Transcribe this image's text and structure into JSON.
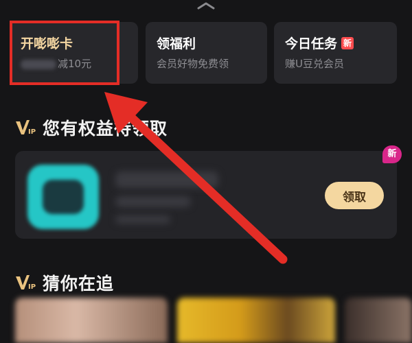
{
  "quick_cards": [
    {
      "title": "开嘭嘭卡",
      "subtitle": "减10元"
    },
    {
      "title": "领福利",
      "subtitle": "会员好物免费领"
    },
    {
      "title": "今日任务",
      "badge": "新",
      "subtitle": "赚U豆兑会员"
    }
  ],
  "rights_section": {
    "title": "您有权益待领取",
    "claim_label": "领取",
    "corner_badge": "新"
  },
  "follow_section": {
    "title": "猜你在追"
  },
  "icons": {
    "vip": "vip-icon",
    "collapse": "chevron-up-icon"
  },
  "colors": {
    "accent_gold": "#f4d6a2",
    "highlight_red": "#e42d26",
    "badge_red": "#ff4d4f",
    "badge_pink": "#d9268a"
  }
}
